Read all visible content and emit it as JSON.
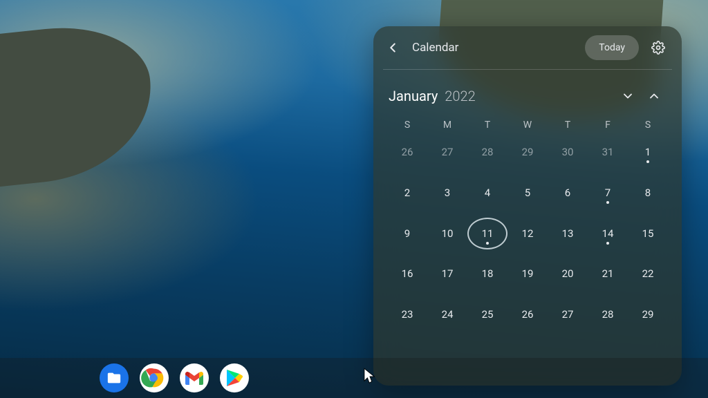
{
  "calendar": {
    "title": "Calendar",
    "today_label": "Today",
    "month": "January",
    "year": "2022",
    "weekdays": [
      "S",
      "M",
      "T",
      "W",
      "T",
      "F",
      "S"
    ],
    "today_day": 11,
    "weeks": [
      [
        {
          "n": 26,
          "other": true
        },
        {
          "n": 27,
          "other": true
        },
        {
          "n": 28,
          "other": true
        },
        {
          "n": 29,
          "other": true
        },
        {
          "n": 30,
          "other": true
        },
        {
          "n": 31,
          "other": true
        },
        {
          "n": 1,
          "event": true
        }
      ],
      [
        {
          "n": 2
        },
        {
          "n": 3
        },
        {
          "n": 4
        },
        {
          "n": 5
        },
        {
          "n": 6
        },
        {
          "n": 7,
          "event": true
        },
        {
          "n": 8
        }
      ],
      [
        {
          "n": 9
        },
        {
          "n": 10
        },
        {
          "n": 11,
          "today": true,
          "event": true
        },
        {
          "n": 12
        },
        {
          "n": 13
        },
        {
          "n": 14,
          "event": true
        },
        {
          "n": 15
        }
      ],
      [
        {
          "n": 16
        },
        {
          "n": 17
        },
        {
          "n": 18
        },
        {
          "n": 19
        },
        {
          "n": 20
        },
        {
          "n": 21
        },
        {
          "n": 22
        }
      ],
      [
        {
          "n": 23
        },
        {
          "n": 24
        },
        {
          "n": 25
        },
        {
          "n": 26
        },
        {
          "n": 27
        },
        {
          "n": 28
        },
        {
          "n": 29
        }
      ]
    ]
  },
  "shelf": {
    "apps": [
      {
        "name": "files",
        "label": "Files"
      },
      {
        "name": "chrome",
        "label": "Chrome"
      },
      {
        "name": "gmail",
        "label": "Gmail"
      },
      {
        "name": "play",
        "label": "Play Store"
      }
    ]
  }
}
